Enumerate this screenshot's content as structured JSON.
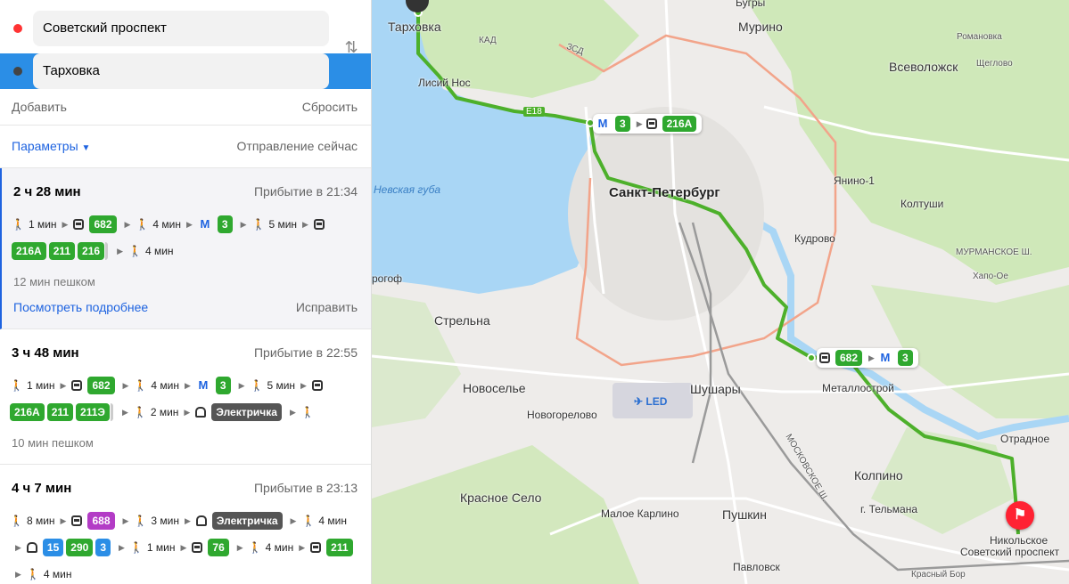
{
  "route_form": {
    "from": "Советский проспект",
    "to": "Тарховка",
    "add_label": "Добавить",
    "reset_label": "Сбросить",
    "swap_icon": "swap-arrows-icon"
  },
  "params": {
    "params_label": "Параметры",
    "departure_label": "Отправление сейчас"
  },
  "routes": [
    {
      "duration": "2 ч 28 мин",
      "arrival": "Прибытие в 21:34",
      "walk1": "1 мин",
      "bus1": "682",
      "walk2": "4 мин",
      "metro": "3",
      "walk3": "5 мин",
      "buses2": [
        "216А",
        "211",
        "216"
      ],
      "walk4": "4 мин",
      "walking_total": "12 мин пешком",
      "details_link": "Посмотреть подробнее",
      "fix_link": "Исправить"
    },
    {
      "duration": "3 ч 48 мин",
      "arrival": "Прибытие в 22:55",
      "walk1": "1 мин",
      "bus1": "682",
      "walk2": "4 мин",
      "metro": "3",
      "walk3": "5 мин",
      "buses2": [
        "216А",
        "211",
        "211Э"
      ],
      "walk4": "2 мин",
      "train": "Электричка",
      "walking_total": "10 мин пешком"
    },
    {
      "duration": "4 ч 7 мин",
      "arrival": "Прибытие в 23:13",
      "walk1": "8 мин",
      "bus1": "688",
      "walk2": "3 мин",
      "train": "Электричка",
      "walk3": "4 мин",
      "trams": [
        "15",
        "290",
        "3"
      ],
      "walk4": "1 мин",
      "bus2": "76",
      "walk5": "4 мин",
      "bus3": "211",
      "walk6": "4 мин"
    }
  ],
  "map": {
    "labels": {
      "spb": "Санкт-Петербург",
      "tarkhovka": "Тарховка",
      "lisiy_nos": "Лисий Нос",
      "nevskaya_guba": "Невская губа",
      "strelna": "Стрельна",
      "novoselye": "Новоселье",
      "novogorelovo": "Новогорелово",
      "krasnoe_selo": "Красное Село",
      "maloe_karlino": "Малое Карлино",
      "shushary": "Шушары",
      "pushkin": "Пушкин",
      "pavlovsk": "Павловск",
      "kolpino": "Колпино",
      "telmana": "г. Тельмана",
      "metallostroy": "Металлострой",
      "otradnoe": "Отрадное",
      "nikolskoe": "Никольское",
      "sovetsky": "Советский проспект",
      "krasny_bor": "Красный Бор",
      "kudrovo": "Кудрово",
      "yanino": "Янино-1",
      "koltushi": "Колтуши",
      "vsevolozhsk": "Всеволожск",
      "murino": "Мурино",
      "bugry": "Бугры",
      "romanovka": "Романовка",
      "shcheglovo": "Щеглово",
      "khapo_oe": "Хапо-Ое",
      "murmanskoe": "МУРМАНСКОЕ Ш.",
      "led": "LED",
      "e18": "E18",
      "kad": "КАД",
      "zsd": "ЗСД",
      "peterhof": "рогоф",
      "moskovskoe": "МОСКОВСКОЕ Ш."
    },
    "chip1": {
      "metro": "3",
      "bus": "216А"
    },
    "chip2": {
      "bus": "682",
      "metro": "3"
    },
    "colors": {
      "route": "#4db02b",
      "water": "#a9d6f5",
      "forest": "#cfe8b9",
      "road": "#ffffff",
      "kad": "#f2a48a"
    }
  }
}
